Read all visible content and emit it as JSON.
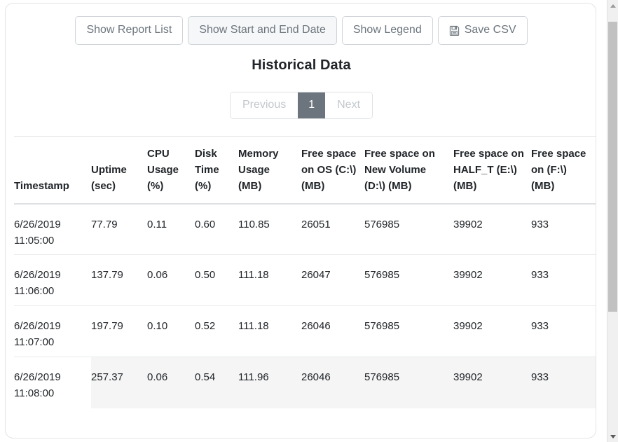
{
  "toolbar": {
    "buttons": [
      {
        "label": "Show Report List",
        "icon": null,
        "state": "normal"
      },
      {
        "label": "Show Start and End Date",
        "icon": null,
        "state": "hovered"
      },
      {
        "label": "Show Legend",
        "icon": null,
        "state": "normal"
      },
      {
        "label": "Save CSV",
        "icon": "floppy-disk-icon",
        "state": "normal"
      }
    ]
  },
  "page": {
    "title": "Historical Data"
  },
  "pagination": {
    "previous_label": "Previous",
    "next_label": "Next",
    "pages": [
      "1"
    ],
    "current_page": "1",
    "active_bg": "#6c757d",
    "disabled_color": "#c3c8cd"
  },
  "table": {
    "headers": [
      "Timestamp",
      "Uptime (sec)",
      "CPU Usage (%)",
      "Disk Time (%)",
      "Memory Usage (MB)",
      "Free space on OS (C:\\) (MB)",
      "Free space on New Volume (D:\\) (MB)",
      "Free space on HALF_T (E:\\) (MB)",
      "Free space on (F:\\) (MB)"
    ],
    "rows": [
      {
        "highlighted": false,
        "cells": [
          "6/26/2019 11:05:00",
          "77.79",
          "0.11",
          "0.60",
          "110.85",
          "26051",
          "576985",
          "39902",
          "933"
        ]
      },
      {
        "highlighted": false,
        "cells": [
          "6/26/2019 11:06:00",
          "137.79",
          "0.06",
          "0.50",
          "111.18",
          "26047",
          "576985",
          "39902",
          "933"
        ]
      },
      {
        "highlighted": false,
        "cells": [
          "6/26/2019 11:07:00",
          "197.79",
          "0.10",
          "0.52",
          "111.18",
          "26046",
          "576985",
          "39902",
          "933"
        ]
      },
      {
        "highlighted": true,
        "cells": [
          "6/26/2019 11:08:00",
          "257.37",
          "0.06",
          "0.54",
          "111.96",
          "26046",
          "576985",
          "39902",
          "933"
        ]
      }
    ]
  },
  "scrollbar": {
    "up_arrow": "scroll-up-arrow-icon",
    "down_arrow": "scroll-down-arrow-icon",
    "thumb_color": "#c1c1c1",
    "track_color": "#f0f0f0"
  }
}
